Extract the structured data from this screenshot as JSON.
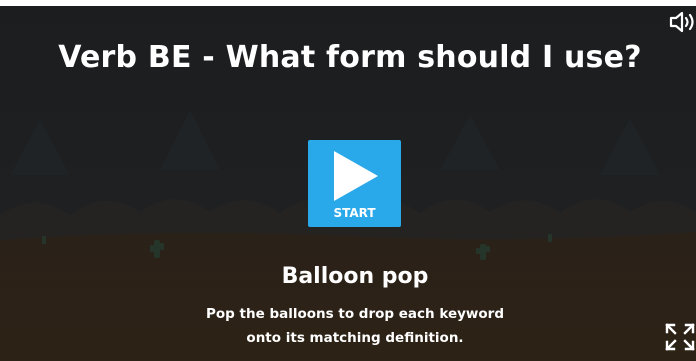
{
  "game": {
    "title": "Verb BE - What form should I use?",
    "start_label": "START",
    "template_name": "Balloon pop",
    "description_line1": "Pop the balloons to drop each keyword",
    "description_line2": "onto its matching definition."
  },
  "icons": {
    "play": "play-icon",
    "sound": "speaker-icon",
    "fullscreen": "fullscreen-icon"
  },
  "colors": {
    "start_button": "#2aa9ea",
    "background": "#1a1c1e",
    "text": "#ffffff"
  }
}
